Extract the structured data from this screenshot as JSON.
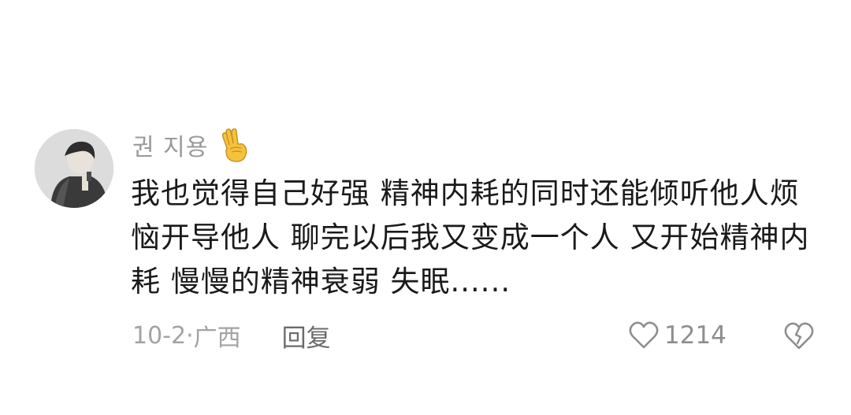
{
  "comment": {
    "username": "권 지용",
    "badge_icon": "victory-hand-emoji",
    "text": "我也觉得自己好强 精神内耗的同时还能倾听他人烦恼开导他人 聊完以后我又变成一个人 又开始精神内耗 慢慢的精神衰弱 失眠......",
    "date": "10-2",
    "separator": "·",
    "location": "广西",
    "reply_label": "回复",
    "like_count": "1214",
    "like_icon": "heart-outline-icon",
    "dislike_icon": "broken-heart-icon"
  },
  "colors": {
    "username": "#9a9a9a",
    "text": "#1a1a1a",
    "meta": "#a3a3a3",
    "reply": "#6b6b6b",
    "icon": "#8e8e8e",
    "emoji": "#f5c33b"
  }
}
